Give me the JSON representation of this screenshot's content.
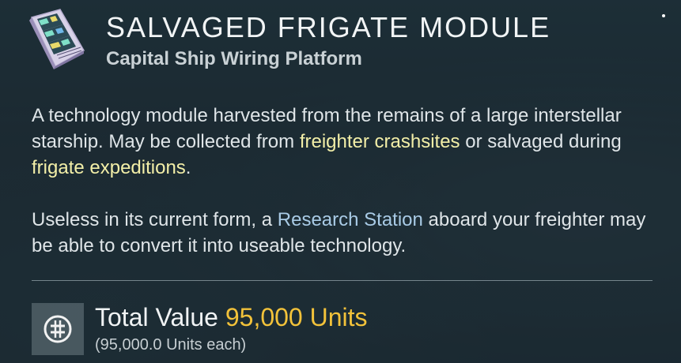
{
  "header": {
    "title": "SALVAGED FRIGATE MODULE",
    "subtitle": "Capital Ship Wiring Platform",
    "icon": "frigate-module-icon"
  },
  "description": {
    "p1_part1": "A technology module harvested from the remains of a large interstellar starship. May be collected from ",
    "p1_highlight1": "freighter crashsites",
    "p1_part2": " or salvaged during ",
    "p1_highlight2": "frigate expeditions",
    "p1_part3": ".",
    "p2_part1": "Useless in its current form, a ",
    "p2_highlight": "Research Station",
    "p2_part2": " aboard your freighter may be able to convert it into useable technology."
  },
  "value": {
    "label": "Total Value ",
    "amount": "95,000 Units",
    "each": "(95,000.0 Units each)",
    "icon": "units-currency-icon"
  },
  "colors": {
    "highlight_yellow": "#f3efa8",
    "highlight_blue": "#a9cbe6",
    "units_gold": "#f2c23a",
    "background": "#1e2d36"
  }
}
